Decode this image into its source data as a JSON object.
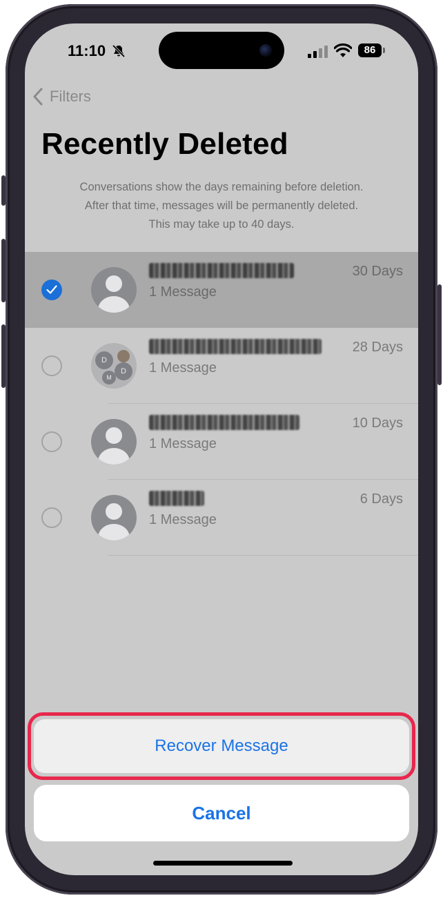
{
  "status_bar": {
    "time": "11:10",
    "battery": "86"
  },
  "nav": {
    "back_label": "Filters"
  },
  "page": {
    "title": "Recently Deleted",
    "description_lines": [
      "Conversations show the days remaining before deletion.",
      "After that time, messages will be permanently deleted.",
      "This may take up to 40 days."
    ]
  },
  "conversations": [
    {
      "subtitle": "1 Message",
      "days": "30 Days",
      "selected": true
    },
    {
      "subtitle": "1 Message",
      "days": "28 Days",
      "selected": false,
      "group_initials": [
        "D",
        "D",
        "M"
      ]
    },
    {
      "subtitle": "1 Message",
      "days": "10 Days",
      "selected": false
    },
    {
      "subtitle": "1 Message",
      "days": "6 Days",
      "selected": false
    }
  ],
  "action_sheet": {
    "recover_label": "Recover Message",
    "cancel_label": "Cancel"
  },
  "colors": {
    "accent": "#1a73e8",
    "highlight_border": "#e8274c"
  }
}
